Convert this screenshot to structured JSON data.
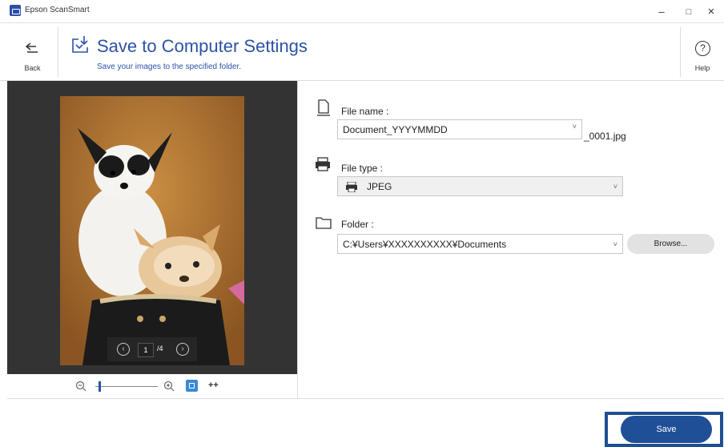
{
  "window": {
    "title": "Epson ScanSmart",
    "controls": {
      "minimize": "–",
      "maximize": "□",
      "close": "×"
    }
  },
  "header": {
    "back_label": "Back",
    "title": "Save to Computer Settings",
    "subtitle": "Save your images to the specified folder.",
    "help_label": "Help",
    "help_glyph": "?"
  },
  "preview": {
    "current_page": "1",
    "total_pages": "/4",
    "prev_glyph": "‹",
    "next_glyph": "›",
    "zoom_level": 0.05,
    "fit_glyph": "++"
  },
  "settings": {
    "file_name": {
      "label": "File name :",
      "value": "Document_YYYYMMDD",
      "suffix": "_0001.jpg"
    },
    "file_type": {
      "label": "File type :",
      "value": "JPEG"
    },
    "folder": {
      "label": "Folder :",
      "value": "C:¥Users¥XXXXXXXXXX¥Documents",
      "browse_label": "Browse..."
    }
  },
  "footer": {
    "save_label": "Save"
  },
  "colors": {
    "accent": "#2b52a8",
    "save_button": "#1f4f96",
    "highlight_frame": "#1e4f8f",
    "preview_bg": "#333333"
  }
}
